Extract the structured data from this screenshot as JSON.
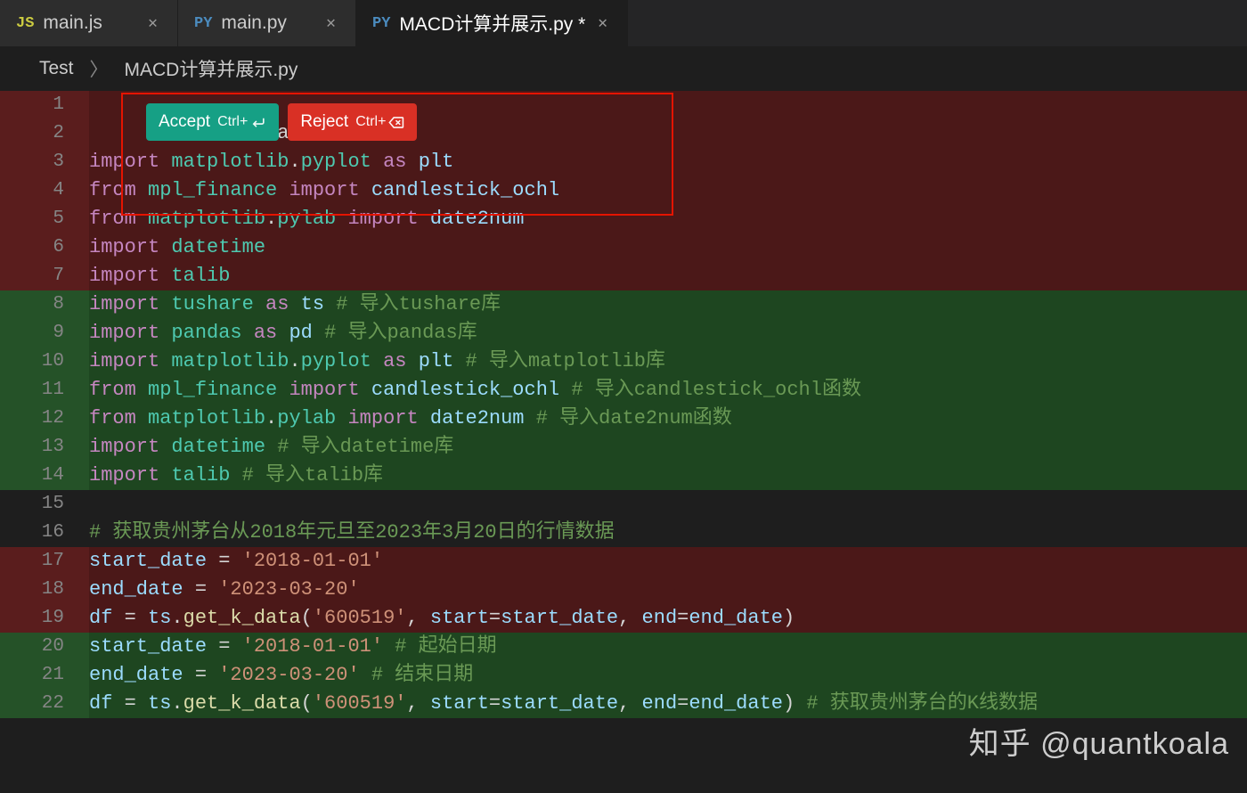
{
  "tabs": [
    {
      "icon": "JS",
      "iconClass": "js",
      "name": "main.js",
      "active": false
    },
    {
      "icon": "PY",
      "iconClass": "py",
      "name": "main.py",
      "active": false
    },
    {
      "icon": "PY",
      "iconClass": "py",
      "name": "MACD计算并展示.py *",
      "active": true
    }
  ],
  "breadcrumb": {
    "root": "Test",
    "file": "MACD计算并展示.py"
  },
  "diff_actions": {
    "accept": {
      "label": "Accept",
      "kbd": "Ctrl+"
    },
    "reject": {
      "label": "Reject",
      "kbd": "Ctrl+"
    }
  },
  "lines": [
    {
      "n": 1,
      "state": "del",
      "tokens": [
        [
          "",
          ""
        ]
      ]
    },
    {
      "n": 2,
      "state": "del",
      "tokens": [
        [
          "tok-def",
          "                a"
        ]
      ]
    },
    {
      "n": 3,
      "state": "del",
      "tokens": [
        [
          "tok-kw",
          "import"
        ],
        [
          "tok-def",
          " "
        ],
        [
          "tok-mod",
          "matplotlib"
        ],
        [
          "tok-def",
          "."
        ],
        [
          "tok-mod",
          "pyplot"
        ],
        [
          "tok-def",
          " "
        ],
        [
          "tok-kw",
          "as"
        ],
        [
          "tok-def",
          " "
        ],
        [
          "tok-id",
          "plt"
        ]
      ]
    },
    {
      "n": 4,
      "state": "del",
      "tokens": [
        [
          "tok-kw",
          "from"
        ],
        [
          "tok-def",
          " "
        ],
        [
          "tok-mod",
          "mpl_finance"
        ],
        [
          "tok-def",
          " "
        ],
        [
          "tok-kw",
          "import"
        ],
        [
          "tok-def",
          " "
        ],
        [
          "tok-id",
          "candlestick_ochl"
        ]
      ]
    },
    {
      "n": 5,
      "state": "del",
      "tokens": [
        [
          "tok-kw",
          "from"
        ],
        [
          "tok-def",
          " "
        ],
        [
          "tok-mod",
          "matplotlib"
        ],
        [
          "tok-def",
          "."
        ],
        [
          "tok-mod",
          "pylab"
        ],
        [
          "tok-def",
          " "
        ],
        [
          "tok-kw",
          "import"
        ],
        [
          "tok-def",
          " "
        ],
        [
          "tok-id",
          "date2num"
        ]
      ]
    },
    {
      "n": 6,
      "state": "del",
      "tokens": [
        [
          "tok-kw",
          "import"
        ],
        [
          "tok-def",
          " "
        ],
        [
          "tok-mod",
          "datetime"
        ]
      ]
    },
    {
      "n": 7,
      "state": "del",
      "tokens": [
        [
          "tok-kw",
          "import"
        ],
        [
          "tok-def",
          " "
        ],
        [
          "tok-mod",
          "talib"
        ]
      ]
    },
    {
      "n": 8,
      "state": "add",
      "tokens": [
        [
          "tok-kw",
          "import"
        ],
        [
          "tok-def",
          " "
        ],
        [
          "tok-mod",
          "tushare"
        ],
        [
          "tok-def",
          " "
        ],
        [
          "tok-kw",
          "as"
        ],
        [
          "tok-def",
          " "
        ],
        [
          "tok-id",
          "ts"
        ],
        [
          "tok-def",
          " "
        ],
        [
          "tok-cmt",
          "# 导入tushare库"
        ]
      ]
    },
    {
      "n": 9,
      "state": "add",
      "tokens": [
        [
          "tok-kw",
          "import"
        ],
        [
          "tok-def",
          " "
        ],
        [
          "tok-mod",
          "pandas"
        ],
        [
          "tok-def",
          " "
        ],
        [
          "tok-kw",
          "as"
        ],
        [
          "tok-def",
          " "
        ],
        [
          "tok-id",
          "pd"
        ],
        [
          "tok-def",
          " "
        ],
        [
          "tok-cmt",
          "# 导入pandas库"
        ]
      ]
    },
    {
      "n": 10,
      "state": "add",
      "tokens": [
        [
          "tok-kw",
          "import"
        ],
        [
          "tok-def",
          " "
        ],
        [
          "tok-mod",
          "matplotlib"
        ],
        [
          "tok-def",
          "."
        ],
        [
          "tok-mod",
          "pyplot"
        ],
        [
          "tok-def",
          " "
        ],
        [
          "tok-kw",
          "as"
        ],
        [
          "tok-def",
          " "
        ],
        [
          "tok-id",
          "plt"
        ],
        [
          "tok-def",
          " "
        ],
        [
          "tok-cmt",
          "# 导入matplotlib库"
        ]
      ]
    },
    {
      "n": 11,
      "state": "add",
      "tokens": [
        [
          "tok-kw",
          "from"
        ],
        [
          "tok-def",
          " "
        ],
        [
          "tok-mod",
          "mpl_finance"
        ],
        [
          "tok-def",
          " "
        ],
        [
          "tok-kw",
          "import"
        ],
        [
          "tok-def",
          " "
        ],
        [
          "tok-id",
          "candlestick_ochl"
        ],
        [
          "tok-def",
          " "
        ],
        [
          "tok-cmt",
          "# 导入candlestick_ochl函数"
        ]
      ]
    },
    {
      "n": 12,
      "state": "add",
      "tokens": [
        [
          "tok-kw",
          "from"
        ],
        [
          "tok-def",
          " "
        ],
        [
          "tok-mod",
          "matplotlib"
        ],
        [
          "tok-def",
          "."
        ],
        [
          "tok-mod",
          "pylab"
        ],
        [
          "tok-def",
          " "
        ],
        [
          "tok-kw",
          "import"
        ],
        [
          "tok-def",
          " "
        ],
        [
          "tok-id",
          "date2num"
        ],
        [
          "tok-def",
          " "
        ],
        [
          "tok-cmt",
          "# 导入date2num函数"
        ]
      ]
    },
    {
      "n": 13,
      "state": "add",
      "tokens": [
        [
          "tok-kw",
          "import"
        ],
        [
          "tok-def",
          " "
        ],
        [
          "tok-mod",
          "datetime"
        ],
        [
          "tok-def",
          " "
        ],
        [
          "tok-cmt",
          "# 导入datetime库"
        ]
      ]
    },
    {
      "n": 14,
      "state": "add",
      "tokens": [
        [
          "tok-kw",
          "import"
        ],
        [
          "tok-def",
          " "
        ],
        [
          "tok-mod",
          "talib"
        ],
        [
          "tok-def",
          " "
        ],
        [
          "tok-cmt",
          "# 导入talib库"
        ]
      ]
    },
    {
      "n": 15,
      "state": "",
      "tokens": [
        [
          "",
          ""
        ]
      ]
    },
    {
      "n": 16,
      "state": "",
      "tokens": [
        [
          "tok-cmt",
          "# 获取贵州茅台从2018年元旦至2023年3月20日的行情数据"
        ]
      ]
    },
    {
      "n": 17,
      "state": "del",
      "tokens": [
        [
          "tok-id",
          "start_date"
        ],
        [
          "tok-def",
          " = "
        ],
        [
          "tok-str",
          "'2018-01-01'"
        ]
      ]
    },
    {
      "n": 18,
      "state": "del",
      "tokens": [
        [
          "tok-id",
          "end_date"
        ],
        [
          "tok-def",
          " = "
        ],
        [
          "tok-str",
          "'2023-03-20'"
        ]
      ]
    },
    {
      "n": 19,
      "state": "del",
      "tokens": [
        [
          "tok-id",
          "df"
        ],
        [
          "tok-def",
          " = "
        ],
        [
          "tok-id",
          "ts"
        ],
        [
          "tok-def",
          "."
        ],
        [
          "tok-fn",
          "get_k_data"
        ],
        [
          "tok-def",
          "("
        ],
        [
          "tok-str",
          "'600519'"
        ],
        [
          "tok-def",
          ", "
        ],
        [
          "tok-id",
          "start"
        ],
        [
          "tok-def",
          "="
        ],
        [
          "tok-id",
          "start_date"
        ],
        [
          "tok-def",
          ", "
        ],
        [
          "tok-id",
          "end"
        ],
        [
          "tok-def",
          "="
        ],
        [
          "tok-id",
          "end_date"
        ],
        [
          "tok-def",
          ")"
        ]
      ]
    },
    {
      "n": 20,
      "state": "add",
      "tokens": [
        [
          "tok-id",
          "start_date"
        ],
        [
          "tok-def",
          " = "
        ],
        [
          "tok-str",
          "'2018-01-01'"
        ],
        [
          "tok-def",
          " "
        ],
        [
          "tok-cmt",
          "# 起始日期"
        ]
      ]
    },
    {
      "n": 21,
      "state": "add",
      "tokens": [
        [
          "tok-id",
          "end_date"
        ],
        [
          "tok-def",
          " = "
        ],
        [
          "tok-str",
          "'2023-03-20'"
        ],
        [
          "tok-def",
          " "
        ],
        [
          "tok-cmt",
          "# 结束日期"
        ]
      ]
    },
    {
      "n": 22,
      "state": "add",
      "tokens": [
        [
          "tok-id",
          "df"
        ],
        [
          "tok-def",
          " = "
        ],
        [
          "tok-id",
          "ts"
        ],
        [
          "tok-def",
          "."
        ],
        [
          "tok-fn",
          "get_k_data"
        ],
        [
          "tok-def",
          "("
        ],
        [
          "tok-str",
          "'600519'"
        ],
        [
          "tok-def",
          ", "
        ],
        [
          "tok-id",
          "start"
        ],
        [
          "tok-def",
          "="
        ],
        [
          "tok-id",
          "start_date"
        ],
        [
          "tok-def",
          ", "
        ],
        [
          "tok-id",
          "end"
        ],
        [
          "tok-def",
          "="
        ],
        [
          "tok-id",
          "end_date"
        ],
        [
          "tok-def",
          ") "
        ],
        [
          "tok-cmt",
          "# 获取贵州茅台的K线数据"
        ]
      ]
    }
  ],
  "watermark": "知乎 @quantkoala"
}
